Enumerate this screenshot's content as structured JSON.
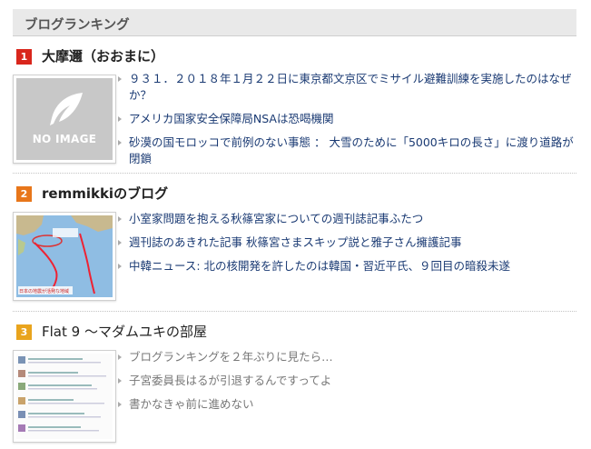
{
  "header": {
    "title": "ブログランキング"
  },
  "colors": {
    "rank1": "#d9261c",
    "rank2": "#e8761a",
    "rank3": "#e9a41d",
    "link": "#1a3a73",
    "muted": "#777777"
  },
  "entries": [
    {
      "rank": "1",
      "title": "大摩邇（おおまに）",
      "thumbnail": {
        "type": "no-image",
        "label": "NO IMAGE",
        "icon": "feather-icon"
      },
      "articles": [
        "９３１．２０１８年１月２２日に東京都文京区でミサイル避難訓練を実施したのはなぜか？",
        "アメリカ国家安全保障局NSAは恐喝機関",
        "砂漠の国モロッコで前例のない事態 ： 大雪のために「5000キロの長さ」に渡り道路が閉鎖"
      ]
    },
    {
      "rank": "2",
      "title": "remmikkiのブログ",
      "thumbnail": {
        "type": "map-image",
        "caption": "日本の地震が活発な地域"
      },
      "articles": [
        "小室家問題を抱える秋篠宮家についての週刊誌記事ふたつ",
        "週刊誌のあきれた記事 秋篠宮さまスキップ説と雅子さん擁護記事",
        "中韓ニュース: 北の核開発を許したのは韓国・習近平氏、９回目の暗殺未遂"
      ]
    },
    {
      "rank": "3",
      "title": "Flat 9 〜マダムユキの部屋",
      "thumbnail": {
        "type": "blog-screenshot"
      },
      "articles": [
        "ブログランキングを２年ぶりに見たら…",
        "子宮委員長はるが引退するんですってよ",
        "書かなきゃ前に進めない"
      ]
    }
  ]
}
